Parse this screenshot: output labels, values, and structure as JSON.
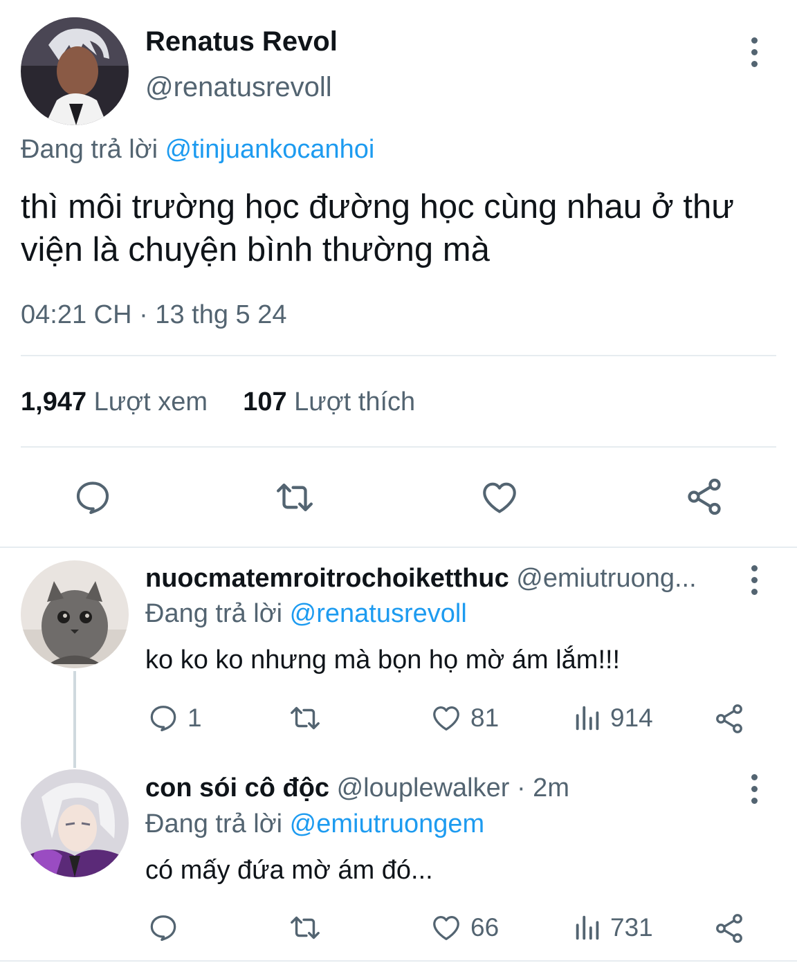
{
  "main_tweet": {
    "display_name": "Renatus Revol",
    "handle": "@renatusrevoll",
    "reply_prefix": "Đang trả lời",
    "reply_to": "@tinjuankocanhoi",
    "text": "thì môi trường học đường học cùng nhau ở thư viện là chuyện bình thường mà",
    "timestamp": "04:21 CH · 13 thg 5 24",
    "views_count": "1,947",
    "views_label": "Lượt xem",
    "likes_count": "107",
    "likes_label": "Lượt thích",
    "actions": [
      "reply-icon",
      "retweet-icon",
      "heart-icon",
      "share-icon"
    ]
  },
  "replies": [
    {
      "display_name": "nuocmatemroitrochoiketthuc",
      "handle_time": "@emiutruong...",
      "reply_prefix": "Đang trả lời",
      "reply_to": "@renatusrevoll",
      "text": "ko ko ko nhưng mà bọn họ mờ ám lắm!!!",
      "reply_count": "1",
      "retweet_count": "",
      "like_count": "81",
      "view_count": "914"
    },
    {
      "display_name": "con sói cô độc",
      "handle_time": "@louplewalker · 2m",
      "reply_prefix": "Đang trả lời",
      "reply_to": "@emiutruongem",
      "text": "có mấy đứa mờ ám đó...",
      "reply_count": "",
      "retweet_count": "",
      "like_count": "66",
      "view_count": "731"
    }
  ],
  "colors": {
    "text": "#0f1419",
    "muted": "#536471",
    "link": "#1d9bf0",
    "divider": "#e6ecf0"
  }
}
